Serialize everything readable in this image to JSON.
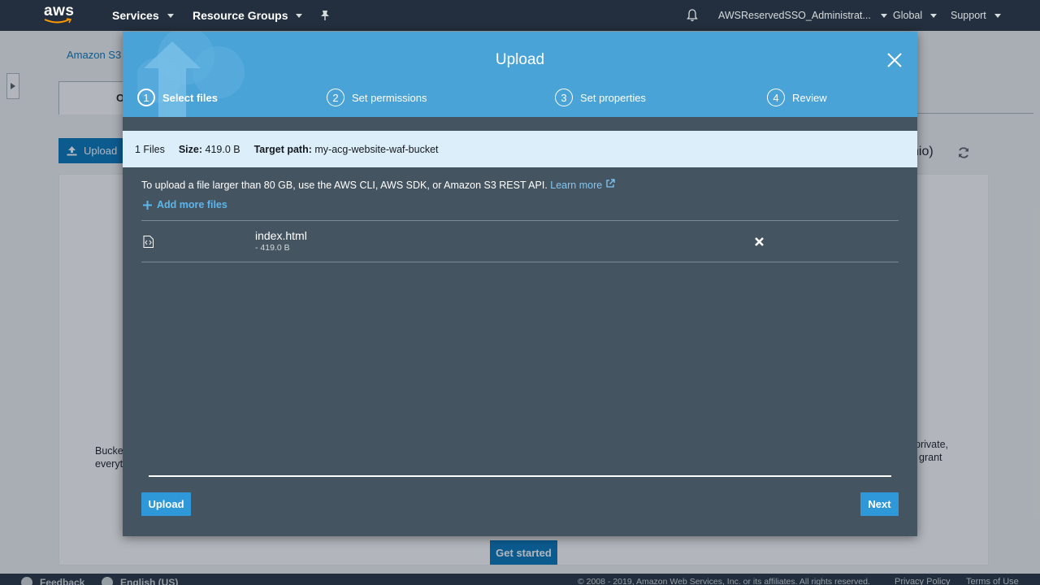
{
  "nav": {
    "logo_text": "aws",
    "services": "Services",
    "resource_groups": "Resource Groups",
    "account": "AWSReservedSSO_Administrat...",
    "region": "Global",
    "support": "Support"
  },
  "background": {
    "breadcrumb": "Amazon S3",
    "tab_label": "O",
    "upload_button": "Upload",
    "region_fragment": "hio)",
    "left_text_line1": "Bucke",
    "left_text_line2": "everyt",
    "right_text_line1": "private,",
    "right_text_line2": "grant",
    "get_started": "Get started"
  },
  "modal": {
    "title": "Upload",
    "steps": [
      {
        "num": "1",
        "label": "Select files"
      },
      {
        "num": "2",
        "label": "Set permissions"
      },
      {
        "num": "3",
        "label": "Set properties"
      },
      {
        "num": "4",
        "label": "Review"
      }
    ],
    "info": {
      "files_count": "1 Files",
      "size_label": "Size:",
      "size_value": "419.0 B",
      "target_label": "Target path:",
      "target_value": "my-acg-website-waf-bucket"
    },
    "notice_text": "To upload a file larger than 80 GB, use the AWS CLI, AWS SDK, or Amazon S3 REST API.",
    "learn_more": "Learn more",
    "add_more_files": "Add more files",
    "file": {
      "name": "index.html",
      "size": "- 419.0 B"
    },
    "upload_button": "Upload",
    "next_button": "Next"
  },
  "footer": {
    "feedback": "Feedback",
    "language": "English (US)",
    "copyright": "© 2008 - 2019, Amazon Web Services, Inc. or its affiliates. All rights reserved.",
    "privacy": "Privacy Policy",
    "terms": "Terms of Use"
  },
  "colors": {
    "nav_bg": "#232f3e",
    "modal_header": "#4aa3d6",
    "modal_body": "#455461",
    "info_bar": "#dbeef9",
    "primary_button": "#2e98d8",
    "link": "#7ec8f5"
  }
}
